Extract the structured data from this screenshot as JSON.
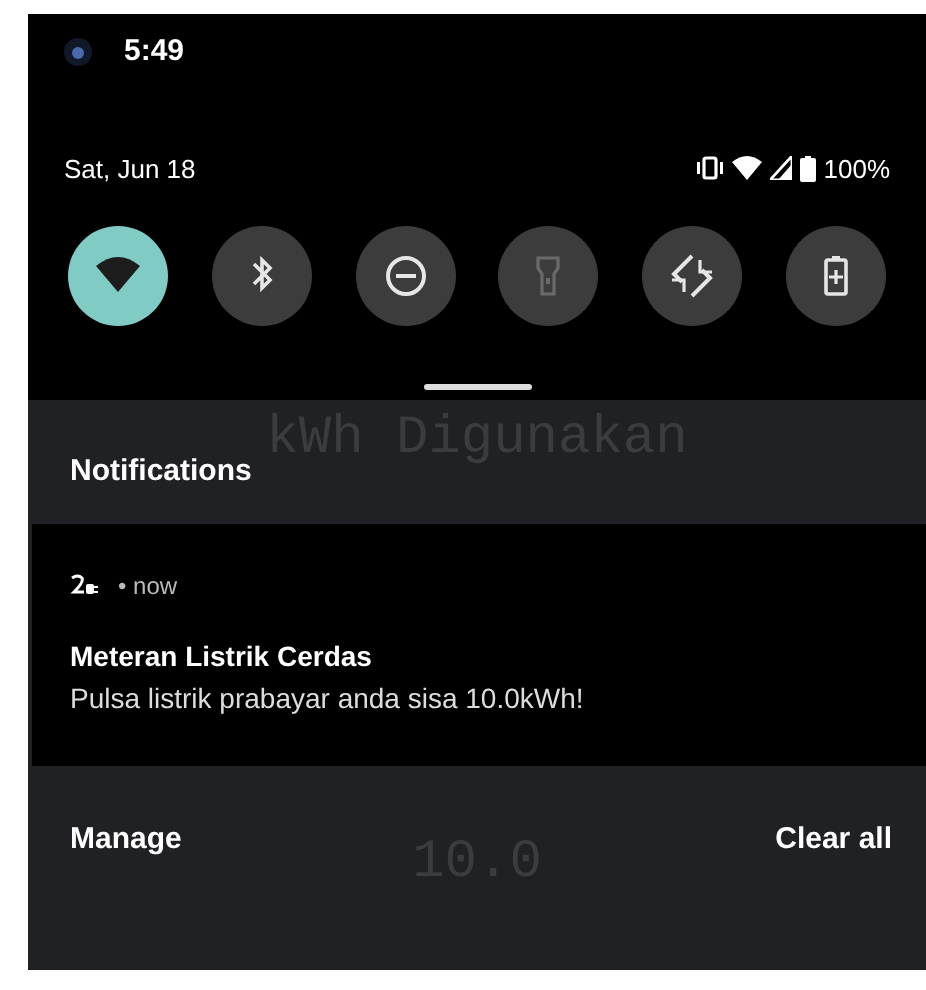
{
  "status_bar": {
    "time": "5:49"
  },
  "header": {
    "date": "Sat, Jun 18",
    "battery": "100%"
  },
  "tiles": [
    {
      "kind": "wifi",
      "on": true,
      "disabled": false
    },
    {
      "kind": "bluetooth",
      "on": false,
      "disabled": false
    },
    {
      "kind": "dnd",
      "on": false,
      "disabled": false
    },
    {
      "kind": "flashlight",
      "on": false,
      "disabled": true
    },
    {
      "kind": "rotate",
      "on": false,
      "disabled": false
    },
    {
      "kind": "battery-saver",
      "on": false,
      "disabled": false
    }
  ],
  "background_app": {
    "label": "kWh Digunakan",
    "value": "10.0"
  },
  "notifications_title": "Notifications",
  "notification": {
    "time": "• now",
    "title": "Meteran Listrik Cerdas",
    "body": "Pulsa listrik prabayar anda sisa 10.0kWh!"
  },
  "footer": {
    "manage": "Manage",
    "clear": "Clear all"
  }
}
